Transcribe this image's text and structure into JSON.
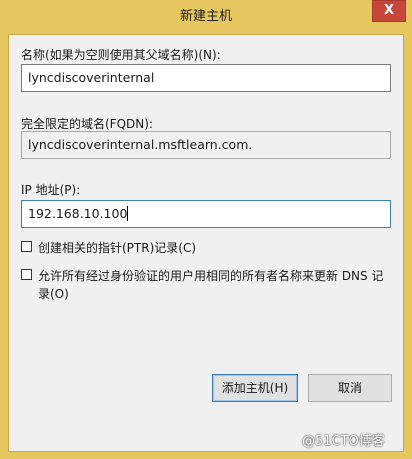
{
  "window": {
    "title": "新建主机",
    "close_glyph": "X"
  },
  "form": {
    "name_label": "名称(如果为空则使用其父域名称)(N):",
    "name_value": "lyncdiscoverinternal",
    "fqdn_label": "完全限定的域名(FQDN):",
    "fqdn_value": "lyncdiscoverinternal.msftlearn.com.",
    "ip_label": "IP 地址(P):",
    "ip_value": "192.168.10.100",
    "ptr_label": "创建相关的指针(PTR)记录(C)",
    "ptr_checked": false,
    "allow_update_label": "允许所有经过身份验证的用户用相同的所有者名称来更新 DNS 记录(O)",
    "allow_update_checked": false
  },
  "buttons": {
    "add_host_label": "添加主机(H)",
    "cancel_label": "取消"
  },
  "watermark": {
    "text": "@51CTO博客"
  }
}
